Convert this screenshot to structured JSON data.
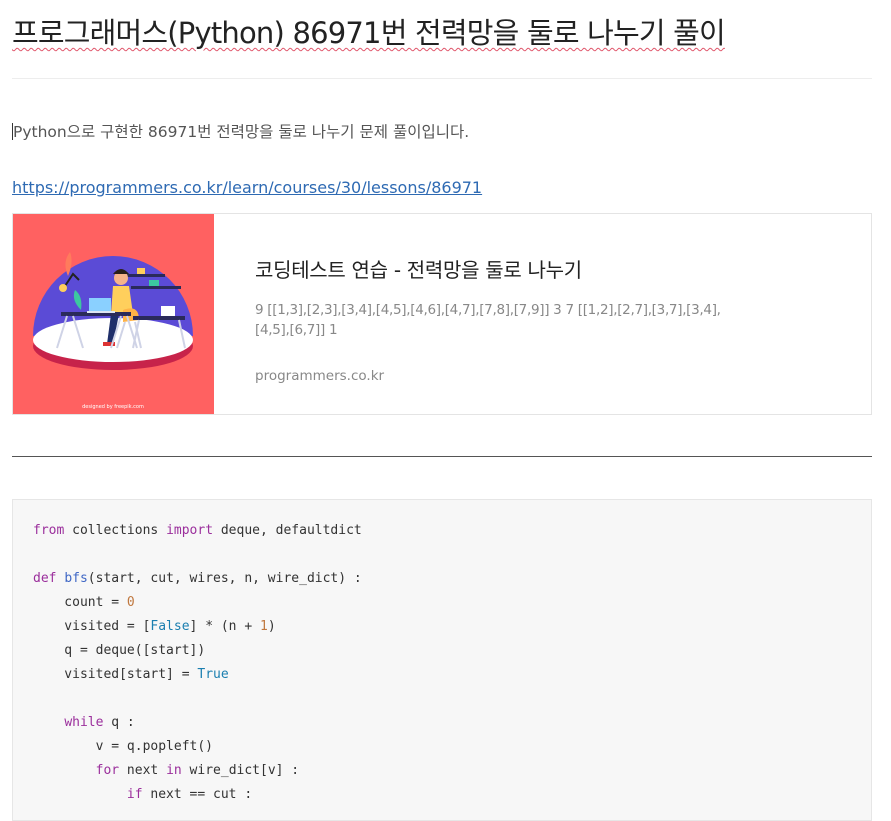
{
  "post": {
    "title": "프로그래머스(Python) 86971번 전력망을 둘로 나누기 풀이",
    "intro": "Python으로 구현한 86971번 전력망을 둘로 나누기 문제 풀이입니다.",
    "link": "https://programmers.co.kr/learn/courses/30/lessons/86971"
  },
  "link_card": {
    "title": "코딩테스트 연습 - 전력망을 둘로 나누기",
    "description": "9 [[1,3],[2,3],[3,4],[4,5],[4,6],[4,7],[7,8],[7,9]] 3 7 [[1,2],[2,7],[3,7],[3,4],[4,5],[6,7]] 1",
    "domain": "programmers.co.kr",
    "thumbnail_credit": "designed by freepik.com",
    "thumbnail_bg": "#ff6161"
  },
  "code": {
    "lines": [
      [
        {
          "t": "from",
          "c": "kw"
        },
        {
          "t": " collections "
        },
        {
          "t": "import",
          "c": "kw"
        },
        {
          "t": " deque, defaultdict"
        }
      ],
      [],
      [
        {
          "t": "def",
          "c": "kw"
        },
        {
          "t": " "
        },
        {
          "t": "bfs",
          "c": "fn"
        },
        {
          "t": "(start, cut, wires, n, wire_dict) :"
        }
      ],
      [
        {
          "t": "    count = "
        },
        {
          "t": "0",
          "c": "num"
        }
      ],
      [
        {
          "t": "    visited = ["
        },
        {
          "t": "False",
          "c": "lit"
        },
        {
          "t": "] * (n + "
        },
        {
          "t": "1",
          "c": "num"
        },
        {
          "t": ")"
        }
      ],
      [
        {
          "t": "    q = deque([start])"
        }
      ],
      [
        {
          "t": "    visited[start] = "
        },
        {
          "t": "True",
          "c": "lit"
        }
      ],
      [],
      [
        {
          "t": "    "
        },
        {
          "t": "while",
          "c": "kw"
        },
        {
          "t": " q :"
        }
      ],
      [
        {
          "t": "        v = q.popleft()"
        }
      ],
      [
        {
          "t": "        "
        },
        {
          "t": "for",
          "c": "kw"
        },
        {
          "t": " next "
        },
        {
          "t": "in",
          "c": "kw"
        },
        {
          "t": " wire_dict[v] :"
        }
      ],
      [
        {
          "t": "            "
        },
        {
          "t": "if",
          "c": "kw"
        },
        {
          "t": " next == cut :"
        }
      ]
    ]
  }
}
